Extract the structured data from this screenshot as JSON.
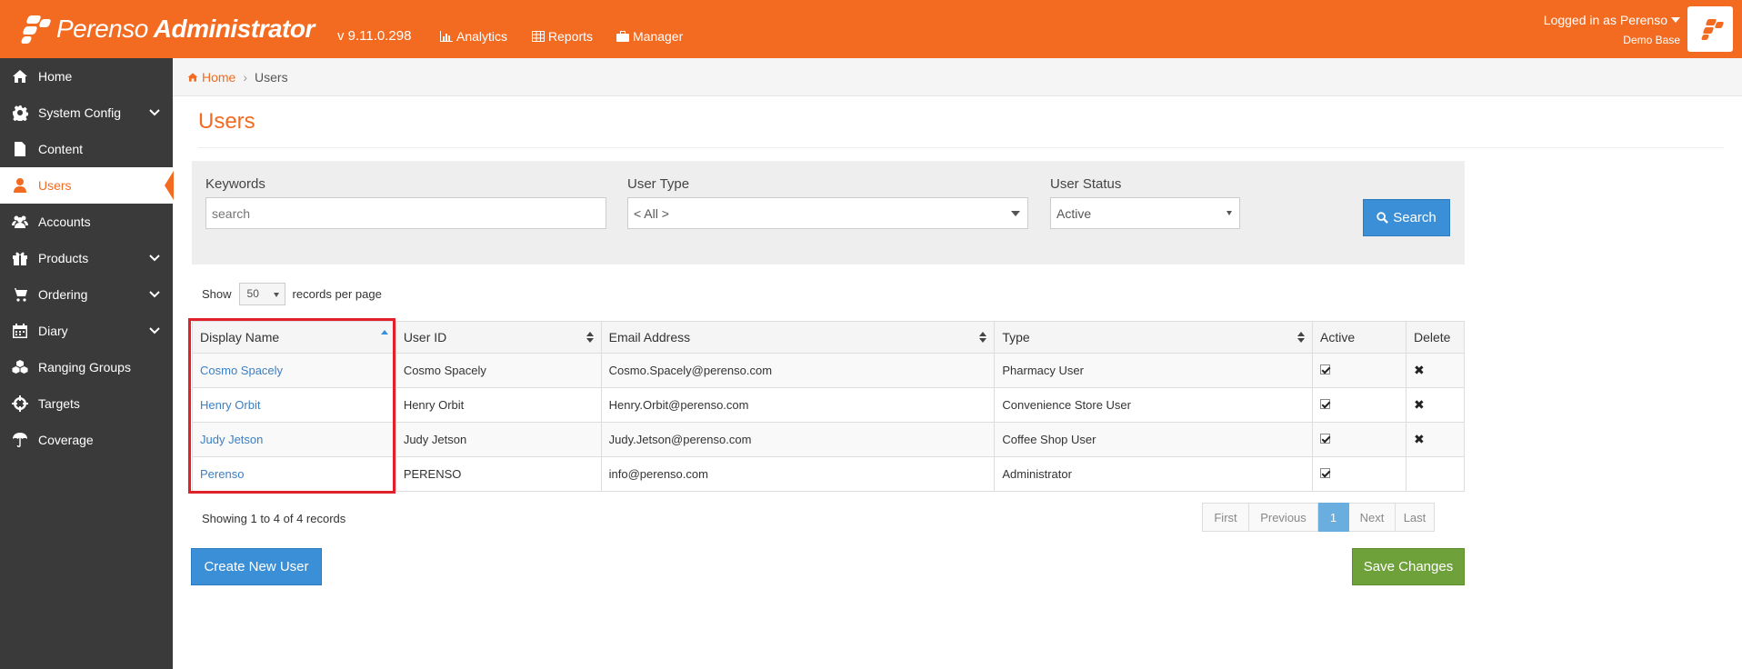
{
  "header": {
    "brand_light": "Perenso",
    "brand_bold": "Administrator",
    "version": "v 9.11.0.298",
    "nav": [
      {
        "label": "Analytics",
        "icon": "bar-chart-icon"
      },
      {
        "label": "Reports",
        "icon": "table-icon"
      },
      {
        "label": "Manager",
        "icon": "briefcase-icon"
      }
    ],
    "logged_in": "Logged in as Perenso",
    "base": "Demo Base"
  },
  "sidebar": {
    "items": [
      {
        "label": "Home",
        "icon": "home-icon",
        "expandable": false
      },
      {
        "label": "System Config",
        "icon": "gear-icon",
        "expandable": true
      },
      {
        "label": "Content",
        "icon": "file-icon",
        "expandable": false
      },
      {
        "label": "Users",
        "icon": "user-icon",
        "expandable": false,
        "active": true
      },
      {
        "label": "Accounts",
        "icon": "users-icon",
        "expandable": false
      },
      {
        "label": "Products",
        "icon": "gift-icon",
        "expandable": true
      },
      {
        "label": "Ordering",
        "icon": "cart-icon",
        "expandable": true
      },
      {
        "label": "Diary",
        "icon": "calendar-icon",
        "expandable": true
      },
      {
        "label": "Ranging Groups",
        "icon": "cubes-icon",
        "expandable": false
      },
      {
        "label": "Targets",
        "icon": "crosshairs-icon",
        "expandable": false
      },
      {
        "label": "Coverage",
        "icon": "umbrella-icon",
        "expandable": false
      }
    ]
  },
  "breadcrumb": {
    "home": "Home",
    "current": "Users"
  },
  "page_title": "Users",
  "filters": {
    "keywords_label": "Keywords",
    "keywords_placeholder": "search",
    "keywords_value": "",
    "user_type_label": "User Type",
    "user_type_value": "< All >",
    "user_status_label": "User Status",
    "user_status_value": "Active",
    "search_label": "Search"
  },
  "paging": {
    "show_label": "Show",
    "per_page": "50",
    "per_page_suffix": "records per page",
    "showing": "Showing 1 to 4 of 4 records",
    "buttons": [
      "First",
      "Previous",
      "1",
      "Next",
      "Last"
    ],
    "current": "1"
  },
  "table": {
    "headers": [
      "Display Name",
      "User ID",
      "Email Address",
      "Type",
      "Active",
      "Delete"
    ],
    "rows": [
      {
        "display_name": "Cosmo Spacely",
        "user_id": "Cosmo Spacely",
        "email": "Cosmo.Spacely@perenso.com",
        "type": "Pharmacy User",
        "active": true,
        "deletable": true
      },
      {
        "display_name": "Henry Orbit",
        "user_id": "Henry Orbit",
        "email": "Henry.Orbit@perenso.com",
        "type": "Convenience Store User",
        "active": true,
        "deletable": true
      },
      {
        "display_name": "Judy Jetson",
        "user_id": "Judy Jetson",
        "email": "Judy.Jetson@perenso.com",
        "type": "Coffee Shop User",
        "active": true,
        "deletable": true
      },
      {
        "display_name": "Perenso",
        "user_id": "PERENSO",
        "email": "info@perenso.com",
        "type": "Administrator",
        "active": true,
        "deletable": false
      }
    ]
  },
  "actions": {
    "create": "Create New User",
    "save": "Save Changes"
  },
  "colors": {
    "brand": "#f26b21",
    "primary": "#3b8fd6",
    "success": "#6fa13b",
    "sidebar": "#3a3a3a",
    "highlight": "#e0202a"
  }
}
